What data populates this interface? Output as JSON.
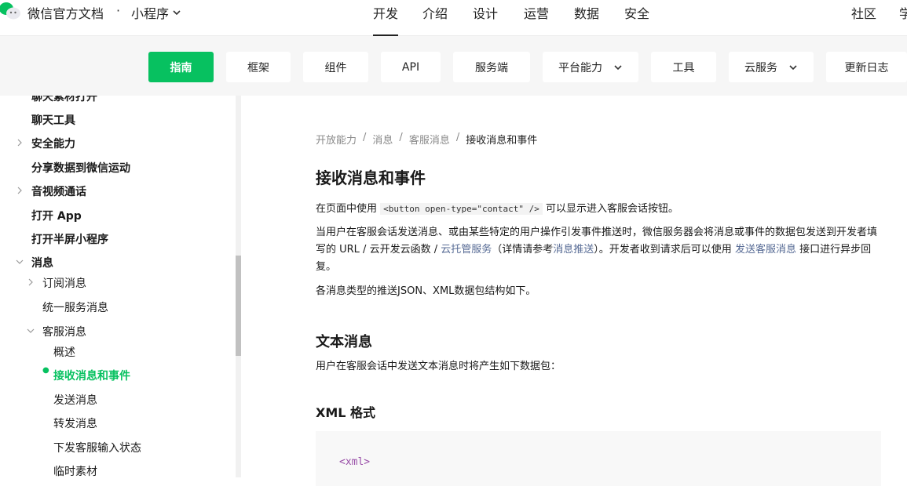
{
  "topnav": {
    "brand": "微信官方文档",
    "dot": "·",
    "product": "小程序",
    "items": [
      {
        "label": "开发",
        "active": true
      },
      {
        "label": "介绍"
      },
      {
        "label": "设计"
      },
      {
        "label": "运营"
      },
      {
        "label": "数据"
      },
      {
        "label": "安全"
      }
    ],
    "right": [
      "社区",
      "学"
    ]
  },
  "subnav": {
    "tabs": [
      {
        "label": "指南",
        "active": true
      },
      {
        "label": "框架"
      },
      {
        "label": "组件"
      },
      {
        "label": "API"
      },
      {
        "label": "服务端"
      },
      {
        "label": "平台能力",
        "dropdown": true
      },
      {
        "label": "工具"
      },
      {
        "label": "云服务",
        "dropdown": true
      },
      {
        "label": "更新日志"
      }
    ]
  },
  "sidebar": {
    "clipped_top": "聊天素材打开",
    "items": [
      {
        "label": "聊天工具"
      },
      {
        "label": "安全能力"
      },
      {
        "label": "分享数据到微信运动"
      },
      {
        "label": "音视频通话"
      },
      {
        "label": "打开 App"
      },
      {
        "label": "打开半屏小程序"
      },
      {
        "label": "消息"
      },
      {
        "label": "订阅消息"
      },
      {
        "label": "统一服务消息"
      },
      {
        "label": "客服消息"
      },
      {
        "label": "概述"
      },
      {
        "label": "接收消息和事件",
        "active": true
      },
      {
        "label": "发送消息"
      },
      {
        "label": "转发消息"
      },
      {
        "label": "下发客服输入状态"
      },
      {
        "label": "临时素材"
      }
    ]
  },
  "main": {
    "breadcrumb": [
      "开放能力",
      "消息",
      "客服消息",
      "接收消息和事件"
    ],
    "breadcrumb_sep": "/",
    "title": "接收消息和事件",
    "p1_pre": "在页面中使用",
    "p1_code": "<button open-type=\"contact\" />",
    "p1_post": "可以显示进入客服会话按钮。",
    "p2_a": "当用户在客服会话发送消息、或由某些特定的用户操作引发事件推送时，微信服务器会将消息或事件的数据包发送到开发者填写的 URL / 云开发云函数 /",
    "p2_link1": "云托管服务",
    "p2_b": "（详情请参考",
    "p2_link2": "消息推送",
    "p2_c": "）。开发者收到请求后可以使用",
    "p2_link3": "发送客服消息",
    "p2_d": "接口进行异步回复。",
    "p3": "各消息类型的推送JSON、XML数据包结构如下。",
    "sec_text": "文本消息",
    "p4": "用户在客服会话中发送文本消息时将产生如下数据包：",
    "sub_xml": "XML 格式",
    "code_line": "<xml>"
  }
}
